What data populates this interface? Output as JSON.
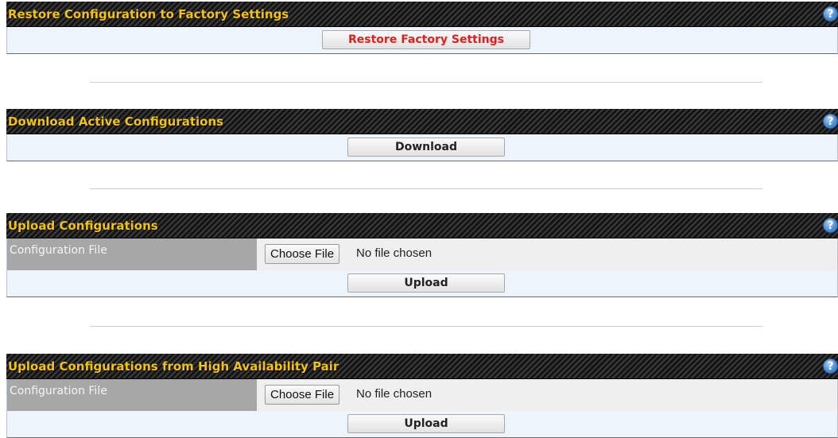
{
  "restore": {
    "title": "Restore Configuration to Factory Settings",
    "button": "Restore Factory Settings"
  },
  "download": {
    "title": "Download Active Configurations",
    "button": "Download"
  },
  "upload": {
    "title": "Upload Configurations",
    "file_label": "Configuration File",
    "choose_button": "Choose File",
    "file_status": "No file chosen",
    "button": "Upload"
  },
  "upload_ha": {
    "title": "Upload Configurations from High Availability Pair",
    "file_label": "Configuration File",
    "choose_button": "Choose File",
    "file_status": "No file chosen",
    "button": "Upload"
  },
  "help_icon": "?",
  "colors": {
    "title_yellow": "#f5c400",
    "restore_red": "#e0201b",
    "row_blue": "#eef4fc",
    "label_gray": "#a7a7a7"
  }
}
